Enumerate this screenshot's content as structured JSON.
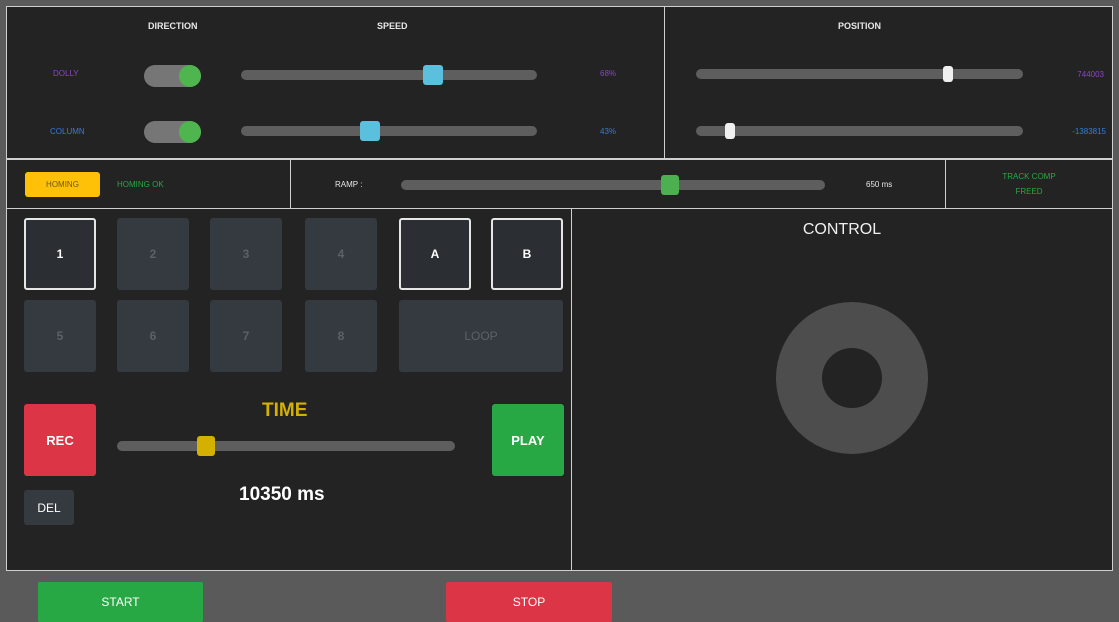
{
  "top": {
    "direction_header": "DIRECTION",
    "speed_header": "SPEED",
    "position_header": "POSITION",
    "dolly_label": "DOLLY",
    "column_label": "COLUMN",
    "dolly_speed_text": "68%",
    "column_speed_text": "43%",
    "dolly_position_text": "744003",
    "column_position_text": "-1383815",
    "dolly_speed_fraction": 0.66,
    "column_speed_fraction": 0.43,
    "dolly_position_fraction": 0.78,
    "column_position_fraction": 0.09
  },
  "status": {
    "homing_button": "HOMING",
    "homing_status": "HOMING OK",
    "ramp_label": "RAMP :",
    "ramp_value": "650 ms",
    "ramp_fraction": 0.64,
    "track_comp_line1": "TRACK COMP",
    "track_comp_line2": "FREED"
  },
  "pads": {
    "p1": "1",
    "p2": "2",
    "p3": "3",
    "p4": "4",
    "pa": "A",
    "pb": "B",
    "p5": "5",
    "p6": "6",
    "p7": "7",
    "p8": "8",
    "loop": "LOOP"
  },
  "time": {
    "title": "TIME",
    "value_text": "10350 ms",
    "fraction": 0.25,
    "rec": "REC",
    "play": "PLAY",
    "del": "DEL"
  },
  "control": {
    "title": "CONTROL"
  },
  "footer": {
    "start": "START",
    "stop": "STOP"
  },
  "colors": {
    "purple": "#8b44c9",
    "blue": "#3a7bd5",
    "green": "#4caf50",
    "cyan": "#5bc0de",
    "yellow": "#ffc107",
    "red": "#dc3545",
    "play_green": "#28a745"
  }
}
